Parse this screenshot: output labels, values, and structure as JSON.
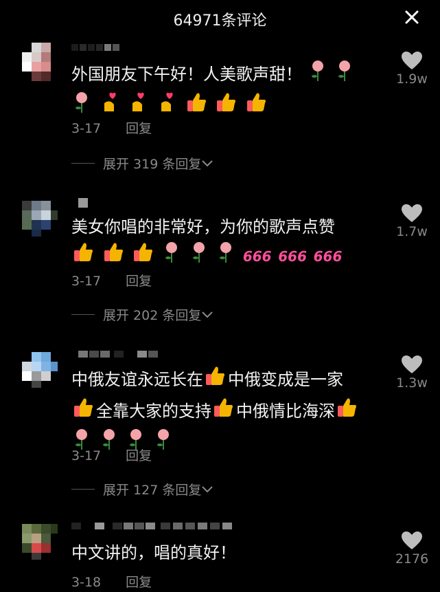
{
  "header": {
    "title": "64971条评论",
    "close_icon": "close-icon"
  },
  "comments": [
    {
      "text1": "外国朋友下午好！人美歌声甜！",
      "text2": "",
      "text3": "",
      "date": "3-17",
      "reply_label": "回复",
      "expand_label": "展开 319 条回复",
      "likes": "1.9w"
    },
    {
      "text1": "美女你唱的非常好，为你的歌声点赞",
      "date": "3-17",
      "reply_label": "回复",
      "expand_label": "展开 202 条回复",
      "likes": "1.7w",
      "emoji_666": "666"
    },
    {
      "text1": "中俄友谊永远长在",
      "text2": "中俄变成是一家",
      "text3": "全靠大家的支持",
      "text4": "中俄情比海深",
      "date": "3-17",
      "reply_label": "回复",
      "expand_label": "展开 127 条回复",
      "likes": "1.3w"
    },
    {
      "text1": "中文讲的，唱的真好！",
      "date": "3-18",
      "reply_label": "回复",
      "likes": "2176"
    }
  ],
  "colors": {
    "background": "#000000",
    "muted": "#8a8a8a",
    "text": "#f2f2f2"
  }
}
